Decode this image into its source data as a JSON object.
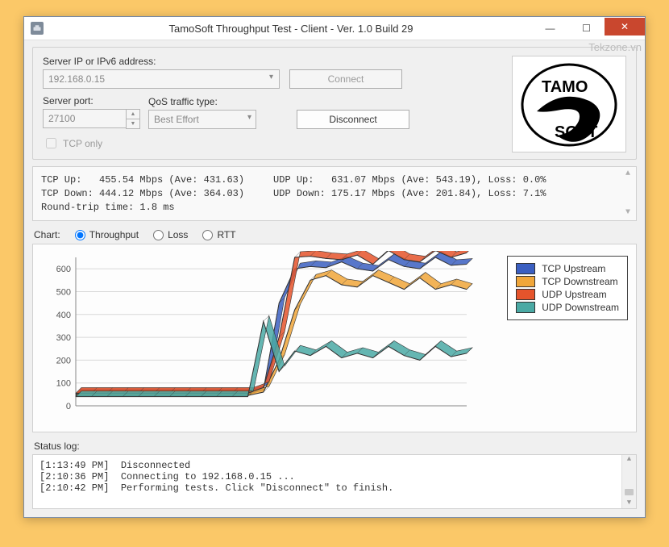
{
  "window": {
    "title": "TamoSoft Throughput Test - Client - Ver. 1.0 Build 29"
  },
  "watermark": "Tekzone.vn",
  "conn": {
    "server_label": "Server IP or IPv6  address:",
    "server_value": "192.168.0.15",
    "port_label": "Server port:",
    "port_value": "27100",
    "qos_label": "QoS traffic type:",
    "qos_value": "Best Effort",
    "connect_label": "Connect",
    "disconnect_label": "Disconnect",
    "tcp_only_label": "TCP only"
  },
  "stats": {
    "line1": "TCP Up:   455.54 Mbps (Ave: 431.63)     UDP Up:   631.07 Mbps (Ave: 543.19), Loss: 0.0%",
    "line2": "TCP Down: 444.12 Mbps (Ave: 364.03)     UDP Down: 175.17 Mbps (Ave: 201.84), Loss: 7.1%",
    "line3": "Round-trip time: 1.8 ms"
  },
  "chart_selector": {
    "label": "Chart:",
    "opt_throughput": "Throughput",
    "opt_loss": "Loss",
    "opt_rtt": "RTT"
  },
  "legend": {
    "tcp_up": {
      "label": "TCP Upstream",
      "color": "#3b5fc1"
    },
    "tcp_down": {
      "label": "TCP Downstream",
      "color": "#f0a63a"
    },
    "udp_up": {
      "label": "UDP Upstream",
      "color": "#e5542c"
    },
    "udp_down": {
      "label": "UDP Downstream",
      "color": "#4aa9a4"
    }
  },
  "status": {
    "label": "Status log:",
    "l1": "[1:13:49 PM]  Disconnected",
    "l2": "[2:10:36 PM]  Connecting to 192.168.0.15 ...",
    "l3": "[2:10:42 PM]  Performing tests. Click \"Disconnect\" to finish."
  },
  "chart_data": {
    "type": "line",
    "title": "",
    "xlabel": "",
    "ylabel": "",
    "ylim": [
      0,
      650
    ],
    "yticks": [
      0,
      100,
      200,
      300,
      400,
      500,
      600
    ],
    "x": [
      0,
      1,
      2,
      3,
      4,
      5,
      6,
      7,
      8,
      9,
      10,
      11,
      12,
      13,
      14,
      15,
      16,
      17,
      18,
      19,
      20,
      21,
      22,
      23,
      24,
      25
    ],
    "series": [
      {
        "name": "TCP Upstream",
        "color": "#3b5fc1",
        "values": [
          50,
          50,
          50,
          50,
          50,
          50,
          50,
          50,
          50,
          50,
          50,
          50,
          70,
          450,
          600,
          610,
          605,
          630,
          600,
          590,
          640,
          610,
          600,
          650,
          615,
          620
        ]
      },
      {
        "name": "TCP Downstream",
        "color": "#f0a63a",
        "values": [
          45,
          45,
          45,
          45,
          45,
          45,
          45,
          45,
          45,
          45,
          45,
          45,
          60,
          200,
          420,
          550,
          570,
          530,
          520,
          570,
          540,
          510,
          560,
          510,
          530,
          510
        ]
      },
      {
        "name": "UDP Upstream",
        "color": "#e5542c",
        "values": [
          55,
          55,
          55,
          55,
          55,
          55,
          55,
          55,
          55,
          55,
          55,
          55,
          80,
          300,
          650,
          655,
          645,
          640,
          660,
          620,
          680,
          640,
          630,
          680,
          650,
          670
        ]
      },
      {
        "name": "UDP Downstream",
        "color": "#4aa9a4",
        "values": [
          40,
          40,
          40,
          40,
          40,
          40,
          40,
          40,
          40,
          40,
          40,
          40,
          370,
          150,
          240,
          220,
          260,
          210,
          230,
          210,
          260,
          220,
          200,
          260,
          215,
          230
        ]
      }
    ]
  }
}
